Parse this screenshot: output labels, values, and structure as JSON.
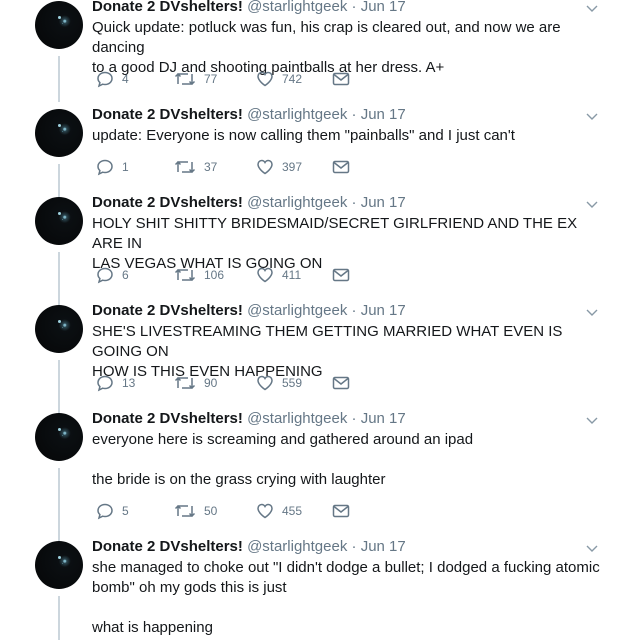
{
  "author": {
    "name": "Donate 2 DVshelters!",
    "handle": "@starlightgeek"
  },
  "tweets": [
    {
      "date": "Jun 17",
      "text": "Quick update: potluck was fun, his crap is cleared out, and now we are dancing\nto a good DJ and shooting paintballs at her dress. A+",
      "replies": "4",
      "retweets": "77",
      "likes": "742"
    },
    {
      "date": "Jun 17",
      "text": "update: Everyone is now calling them \"painballs\" and I just can't",
      "replies": "1",
      "retweets": "37",
      "likes": "397"
    },
    {
      "date": "Jun 17",
      "text": "HOLY SHIT SHITTY BRIDESMAID/SECRET GIRLFRIEND AND THE EX ARE IN\nLAS VEGAS WHAT IS GOING ON",
      "replies": "6",
      "retweets": "106",
      "likes": "411"
    },
    {
      "date": "Jun 17",
      "text": "SHE'S LIVESTREAMING THEM GETTING MARRIED WHAT EVEN IS GOING ON\nHOW IS THIS EVEN HAPPENING",
      "replies": "13",
      "retweets": "90",
      "likes": "559"
    },
    {
      "date": "Jun 17",
      "text": "everyone here is screaming and gathered around an ipad\n\nthe bride is on the grass crying with laughter",
      "replies": "5",
      "retweets": "50",
      "likes": "455"
    },
    {
      "date": "Jun 17",
      "text": "she managed to choke out \"I didn't dodge a bullet; I dodged a fucking atomic\nbomb\" oh my gods this is just\n\nwhat is happening"
    }
  ],
  "colors": {
    "text": "#14171a",
    "meta": "#657786",
    "thread_line": "#ccd6dd"
  }
}
